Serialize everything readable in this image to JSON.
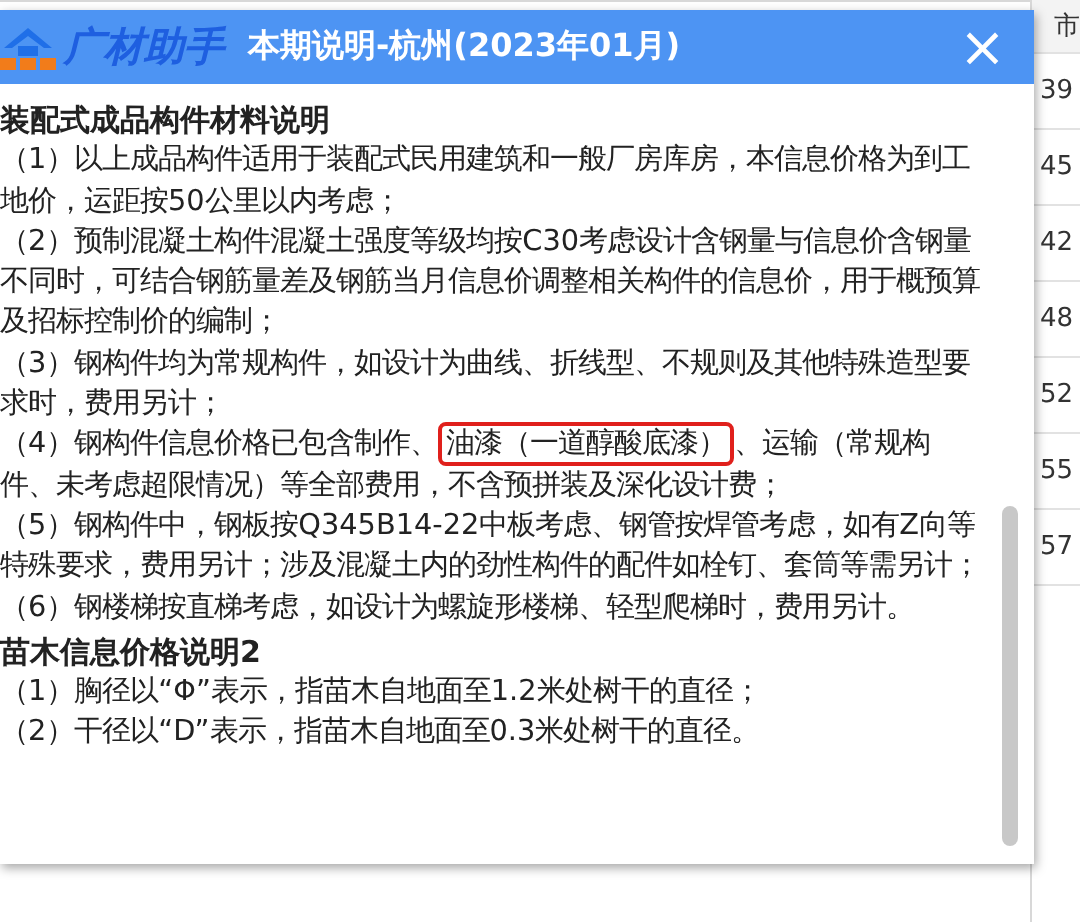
{
  "sheet": {
    "header": "市",
    "cells": [
      "39",
      "45",
      "42",
      "48",
      "52",
      "55",
      "57"
    ]
  },
  "dialog": {
    "logo_text": "广材助手",
    "title": "本期说明-杭州(2023年01月)",
    "close": "×",
    "sections": [
      {
        "heading": "装配式成品构件材料说明",
        "items": [
          {
            "parts": [
              {
                "text": "（1）以上成品构件适用于装配式民用建筑和一般厂房库房，本信息价格为到工地价，运距按50公里以内考虑；",
                "highlighted": false
              }
            ]
          },
          {
            "parts": [
              {
                "text": "（2）预制混凝土构件混凝土强度等级均按C30考虑设计含钢量与信息价含钢量不同时，可结合钢筋量差及钢筋当月信息价调整相关构件的信息价，用于概预算及招标控制价的编制；",
                "highlighted": false
              }
            ]
          },
          {
            "parts": [
              {
                "text": "（3）钢构件均为常规构件，如设计为曲线、折线型、不规则及其他特殊造型要求时，费用另计；",
                "highlighted": false
              }
            ]
          },
          {
            "parts": [
              {
                "text": "（4）钢构件信息价格已包含制作、",
                "highlighted": false
              },
              {
                "text": "油漆（一道醇酸底漆）",
                "highlighted": true
              },
              {
                "text": "、运输（常规构件、未考虑超限情况）等全部费用，不含预拼装及深化设计费；",
                "highlighted": false
              }
            ]
          },
          {
            "parts": [
              {
                "text": "（5）钢构件中，钢板按Q345B14-22中板考虑、钢管按焊管考虑，如有Z向等特殊要求，费用另计；涉及混凝土内的劲性构件的配件如栓钉、套筒等需另计；",
                "highlighted": false
              }
            ]
          },
          {
            "parts": [
              {
                "text": "（6）钢楼梯按直梯考虑，如设计为螺旋形楼梯、轻型爬梯时，费用另计。",
                "highlighted": false
              }
            ]
          }
        ]
      },
      {
        "heading": "苗木信息价格说明2",
        "items": [
          {
            "parts": [
              {
                "text": "（1）胸径以“Φ”表示，指苗木自地面至1.2米处树干的直径；",
                "highlighted": false
              }
            ]
          },
          {
            "parts": [
              {
                "text": "（2）干径以“D”表示，指苗木自地面至0.3米处树干的直径。",
                "highlighted": false
              }
            ]
          }
        ]
      }
    ]
  }
}
